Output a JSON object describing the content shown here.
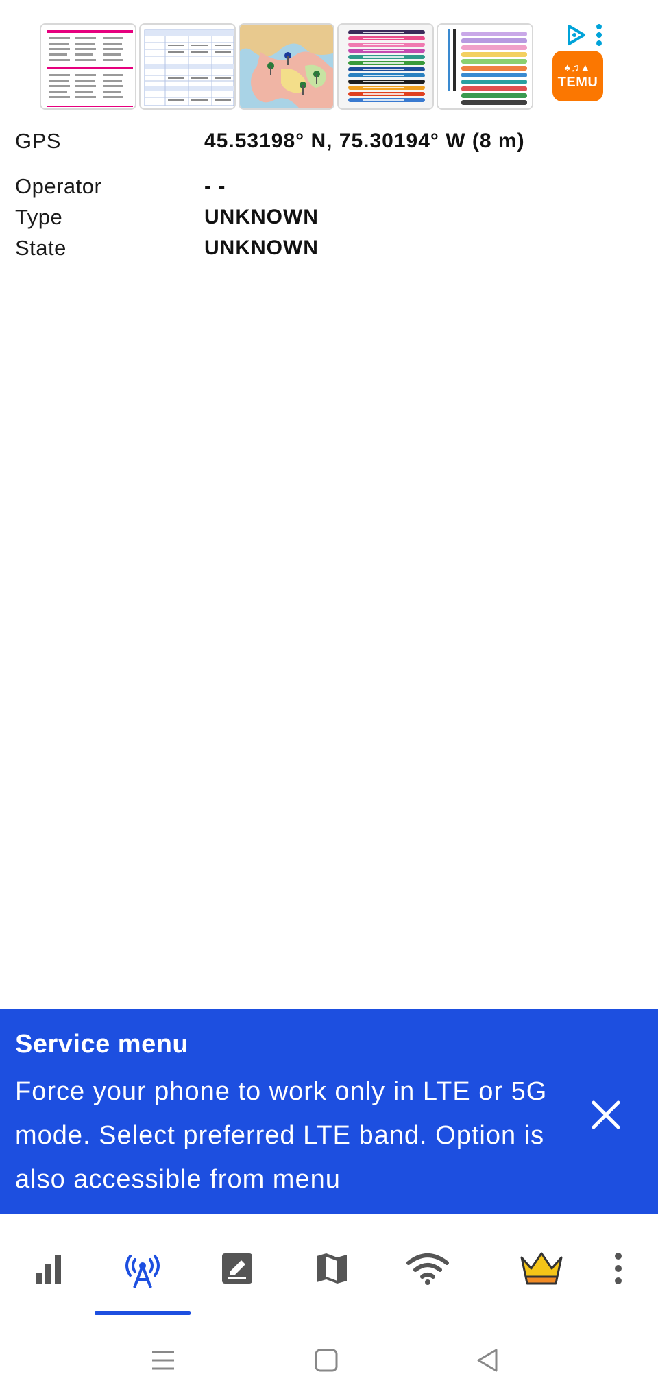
{
  "ad": {
    "logo_text": "TEMU",
    "thumbnails": [
      "pen-sheet-pink",
      "pen-sheet-blue",
      "map-with-pins",
      "colorful-pens-labeled",
      "colorful-pens"
    ]
  },
  "info": {
    "gps": {
      "label": "GPS",
      "value": "45.53198° N, 75.30194° W (8 m)"
    },
    "operator": {
      "label": "Operator",
      "value": "- -"
    },
    "type": {
      "label": "Type",
      "value": "UNKNOWN"
    },
    "state": {
      "label": "State",
      "value": "UNKNOWN"
    }
  },
  "service_menu": {
    "title": "Service menu",
    "text": "Force your phone to work only in LTE or 5G mode. Select preferred LTE band. Option is also accessible from menu"
  },
  "bottom_nav": {
    "items": [
      {
        "name": "signal",
        "icon": "signal-bars-icon",
        "active": false
      },
      {
        "name": "cell-tower",
        "icon": "antenna-icon",
        "active": true
      },
      {
        "name": "log",
        "icon": "edit-note-icon",
        "active": false
      },
      {
        "name": "map",
        "icon": "map-icon",
        "active": false
      },
      {
        "name": "wifi",
        "icon": "wifi-icon",
        "active": false
      },
      {
        "name": "premium",
        "icon": "crown-icon",
        "active": false
      },
      {
        "name": "more",
        "icon": "more-vertical-icon",
        "active": false
      }
    ]
  },
  "colors": {
    "accent": "#1d4fe0",
    "icon_gray": "#555555",
    "crown_gold": "#f5c518",
    "crown_orange": "#f08a24",
    "temu_orange": "#fb7701",
    "ad_choices": "#00a3d9"
  }
}
